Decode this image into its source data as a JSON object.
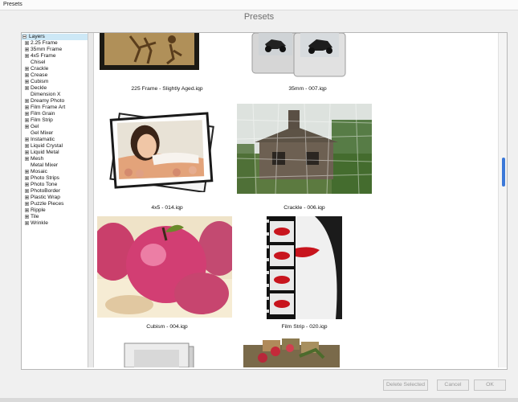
{
  "window": {
    "title": "Presets"
  },
  "dialog": {
    "heading": "Presets"
  },
  "tree": {
    "items": [
      {
        "label": "Layers",
        "expander": "minus",
        "selected": true
      },
      {
        "label": "2.25 Frame",
        "expander": "plus"
      },
      {
        "label": "35mm Frame",
        "expander": "plus"
      },
      {
        "label": "4x5 Frame",
        "expander": "plus"
      },
      {
        "label": "Chisel",
        "expander": "none"
      },
      {
        "label": "Crackle",
        "expander": "plus"
      },
      {
        "label": "Crease",
        "expander": "plus"
      },
      {
        "label": "Cubism",
        "expander": "plus"
      },
      {
        "label": "Deckle",
        "expander": "plus"
      },
      {
        "label": "Dimension X",
        "expander": "none"
      },
      {
        "label": "Dreamy Photo",
        "expander": "plus"
      },
      {
        "label": "Film Frame Art",
        "expander": "plus"
      },
      {
        "label": "Film Grain",
        "expander": "plus"
      },
      {
        "label": "Film Strip",
        "expander": "plus"
      },
      {
        "label": "Gel",
        "expander": "plus"
      },
      {
        "label": "Gel Mixer",
        "expander": "none"
      },
      {
        "label": "Instamatic",
        "expander": "plus"
      },
      {
        "label": "Liquid Crystal",
        "expander": "plus"
      },
      {
        "label": "Liquid Metal",
        "expander": "plus"
      },
      {
        "label": "Mesh",
        "expander": "plus"
      },
      {
        "label": "Metal Mixer",
        "expander": "none"
      },
      {
        "label": "Mosaic",
        "expander": "plus"
      },
      {
        "label": "Photo Strips",
        "expander": "plus"
      },
      {
        "label": "Photo Tone",
        "expander": "plus"
      },
      {
        "label": "PhotoBorder",
        "expander": "plus"
      },
      {
        "label": "Plastic Wrap",
        "expander": "plus"
      },
      {
        "label": "Puzzle Pieces",
        "expander": "plus"
      },
      {
        "label": "Ripple",
        "expander": "plus"
      },
      {
        "label": "Tile",
        "expander": "plus"
      },
      {
        "label": "Wrinkle",
        "expander": "plus"
      }
    ]
  },
  "presets": [
    {
      "caption": "225 Frame - Slightly Aged.iqp"
    },
    {
      "caption": "35mm - 007.iqp"
    },
    {
      "caption": "4x5 - 014.iqp"
    },
    {
      "caption": "Crackle - 006.iqp"
    },
    {
      "caption": "Cubism - 004.iqp"
    },
    {
      "caption": "Film Strip - 020.iqp"
    }
  ],
  "buttons": {
    "delete_selected": "Delete Selected",
    "cancel": "Cancel",
    "ok": "OK"
  },
  "colors": {
    "selection": "#cde8f6",
    "scroll_thumb": "#3b78d8"
  }
}
